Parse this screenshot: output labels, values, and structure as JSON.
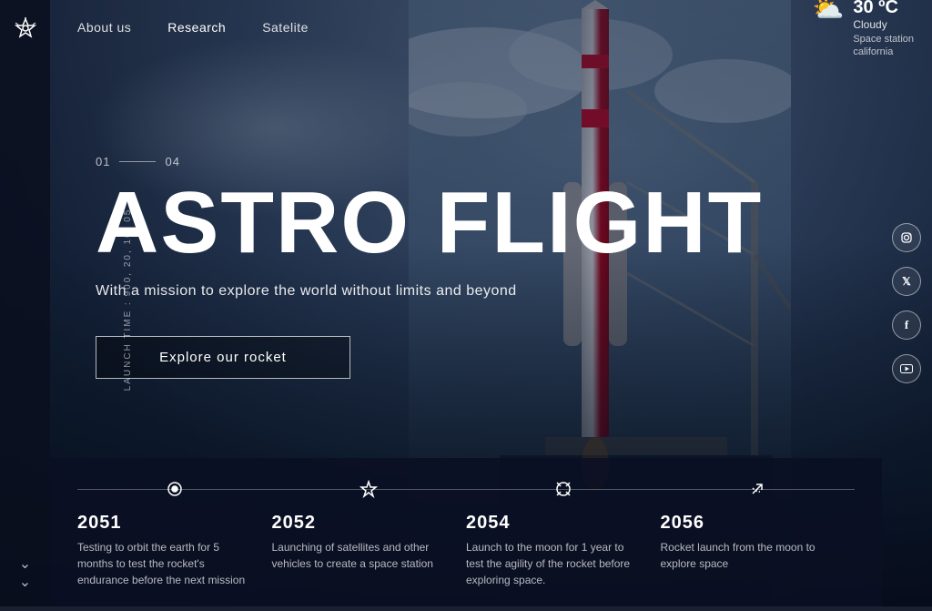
{
  "site": {
    "logo_icon": "🚀",
    "name": "AstroFlight"
  },
  "nav": {
    "links": [
      {
        "label": "About us",
        "active": false
      },
      {
        "label": "Research",
        "active": true
      },
      {
        "label": "Satelite",
        "active": false
      }
    ]
  },
  "weather": {
    "icon": "⛅",
    "temperature": "30 ºC",
    "condition": "Cloudy",
    "location_line1": "Space station",
    "location_line2": "california"
  },
  "hero": {
    "slide_current": "01",
    "slide_total": "04",
    "title": "ASTRO FLIGHT",
    "subtitle": "With a mission to explore the world without limits and beyond",
    "cta_label": "Explore our rocket"
  },
  "sidebar_left": {
    "launch_label": "Launch time :",
    "launch_time": "900, 20, 10, 05"
  },
  "social": {
    "icons": [
      {
        "name": "instagram-icon",
        "symbol": "📷"
      },
      {
        "name": "twitter-icon",
        "symbol": "𝕏"
      },
      {
        "name": "facebook-icon",
        "symbol": "f"
      },
      {
        "name": "youtube-icon",
        "symbol": "▶"
      }
    ]
  },
  "timeline": {
    "items": [
      {
        "year": "2051",
        "icon": "◎",
        "description": "Testing to orbit the earth for 5 months to test the rocket's endurance before the next mission"
      },
      {
        "year": "2052",
        "icon": "◉",
        "description": "Launching of satellites and other vehicles to create a space station"
      },
      {
        "year": "2054",
        "icon": "✦",
        "description": "Launch to the moon for 1 year to test the agility of the rocket before exploring space."
      },
      {
        "year": "2056",
        "icon": "↗",
        "description": "Rocket launch from the moon to explore space"
      }
    ]
  },
  "colors": {
    "background_dark": "#0a0f1e",
    "accent_white": "#ffffff",
    "text_muted": "rgba(255,255,255,0.6)"
  }
}
